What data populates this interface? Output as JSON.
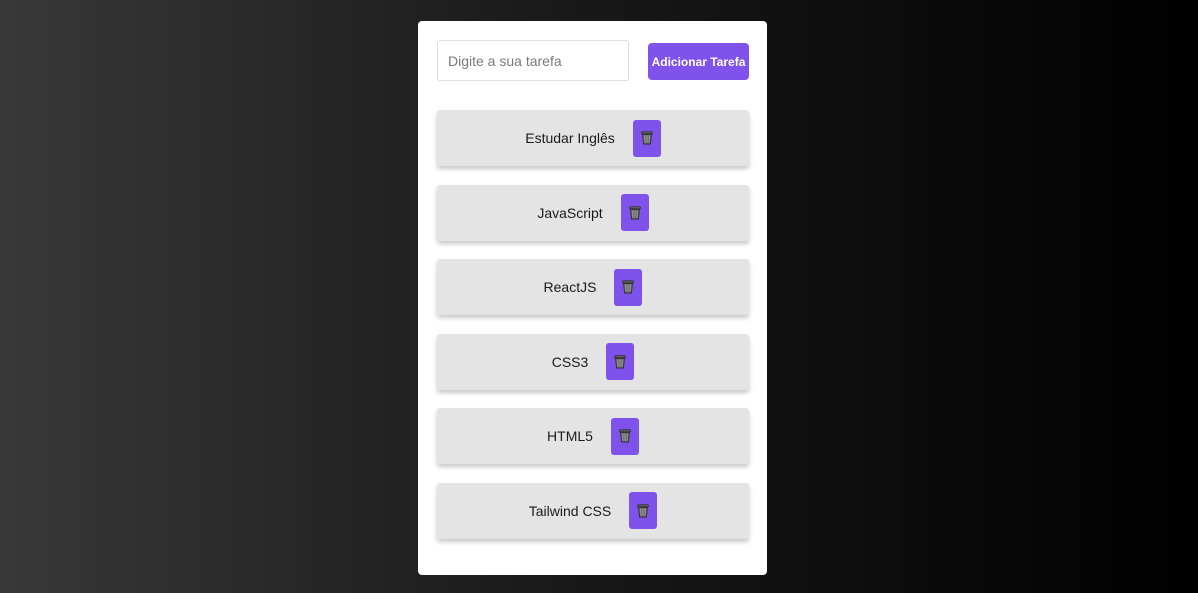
{
  "form": {
    "input_placeholder": "Digite a sua tarefa",
    "input_value": "",
    "add_button_label": "Adicionar Tarefa"
  },
  "tasks": [
    {
      "label": "Estudar Inglês",
      "delete_icon": "trash-icon"
    },
    {
      "label": "JavaScript",
      "delete_icon": "trash-icon"
    },
    {
      "label": "ReactJS",
      "delete_icon": "trash-icon"
    },
    {
      "label": "CSS3",
      "delete_icon": "trash-icon"
    },
    {
      "label": "HTML5",
      "delete_icon": "trash-icon"
    },
    {
      "label": "Tailwind CSS",
      "delete_icon": "trash-icon"
    }
  ],
  "colors": {
    "accent": "#8052ec",
    "card_background": "#ffffff",
    "task_background": "#e4e4e4"
  }
}
